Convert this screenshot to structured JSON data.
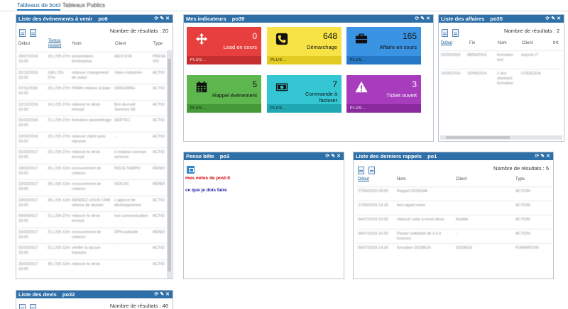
{
  "tabs": [
    {
      "label": "Tableaux de bord"
    },
    {
      "label": "Tableaux Publics"
    }
  ],
  "events_panel": {
    "title": "Liste des événements à venir",
    "code": "po6",
    "results": "Nombre de résultats : 20",
    "headers": [
      "Début",
      "Temps restant",
      "Nom",
      "Client",
      "Type"
    ],
    "rows": [
      [
        "28/07/2016 16:00",
        "18 j 22h 27m",
        "présentation d'entreprise",
        "AIEX HTA",
        "PRESE VIS"
      ],
      [
        "01/12/2016 10:00",
        "148 j 22h 27m",
        "relancer changement de statut",
        "Voleo Industries",
        "ACTIO"
      ],
      [
        "07/11/2016 16:00",
        "23 j 22h 27m",
        "PRAKI relance & base",
        "GREENING",
        "ACTIO"
      ],
      [
        "12/12/2016 16:00",
        "14 j 22h 27m",
        "relancer le devis envoyé",
        "Bon-Accueil Services SE",
        "ACTIO"
      ],
      [
        "01/02/2016 16:00",
        "21 j 22h 27m",
        "formation paramétrage",
        "SERTEC",
        "ACTIO"
      ],
      [
        "22/02/2016 16:00",
        "23 j 22h 27m",
        "relancer client sans réponse",
        "-",
        "ACTIO"
      ],
      [
        "01/02/2017 16:00",
        "23 j 22h 27m",
        "relancer le devis envoyé",
        "e-malaise concept services",
        "ACTIO"
      ],
      [
        "18/02/2017 16:00",
        "25 j 22h 12m",
        "recouvrement de créance",
        "PIZZA TEMPO",
        "RENDI"
      ],
      [
        "22/02/2017 16:00",
        "28 j 22h 12m",
        "recouvrement de créance",
        "ISOLOC",
        "RENDI"
      ],
      [
        "23/03/2017 16:00",
        "28 j 22h 12m",
        "RENDEZ-VOUS CRM relance de dossier",
        "L'agence de développement",
        "ACTIO"
      ],
      [
        "04/04/2017 16:00",
        "21 j 22h 27m",
        "relancer le devis envoyé",
        "eox communication",
        "ACTIO"
      ],
      [
        "15/03/2017 16:00",
        "21 j 22h 12m",
        "recouvrement de créance",
        "DPH publicité",
        "RENDI"
      ],
      [
        "01/03/2017 16:00",
        "21 j 22h 12m",
        "vérifier la facture impayée",
        "-",
        "ACTIO"
      ],
      [
        "26/03/2017 16:00",
        "30 j 22h 12m",
        "relancer le devis",
        "-",
        "ACTIO"
      ]
    ]
  },
  "indicators_panel": {
    "title": "Mes indicateurs",
    "code": "po39",
    "more_label": "PLUS...",
    "tiles": [
      {
        "value": "0",
        "label": "Lead en cours",
        "icon": "move-arrows-icon",
        "color": "#e63f3d",
        "dark": "#c52f2e",
        "text": "#ffffff"
      },
      {
        "value": "648",
        "label": "Démarchage",
        "icon": "phone-icon",
        "color": "#f8e346",
        "dark": "#e4cb22",
        "text": "#111111"
      },
      {
        "value": "165",
        "label": "Affaire en cours",
        "icon": "briefcase-icon",
        "color": "#3a93e3",
        "dark": "#2478c6",
        "text": "#111111"
      },
      {
        "value": "5",
        "label": "Rappel événement",
        "icon": "calendar-icon",
        "color": "#5db64e",
        "dark": "#439a36",
        "text": "#111111"
      },
      {
        "value": "7",
        "label": "Commande à facturer",
        "icon": "money-icon",
        "color": "#35c6d3",
        "dark": "#20a7b4",
        "text": "#111111"
      },
      {
        "value": "3",
        "label": "Ticket ouvert",
        "icon": "warning-icon",
        "color": "#a73cbd",
        "dark": "#8a2a9e",
        "text": "#ffffff"
      }
    ]
  },
  "deals_panel": {
    "title": "Liste des affaires",
    "code": "po35",
    "results": "Nombre de résultats : 2",
    "headers": [
      "Début",
      "Fin",
      "Nom",
      "Client",
      "tHt"
    ],
    "rows": [
      [
        "02/05/2016",
        "08/06/2016",
        "formation test",
        "exporio IT",
        ""
      ],
      [
        "15/05/2016",
        "15/06/2016",
        "2 ans standard formation",
        "CODEQUA",
        ""
      ]
    ]
  },
  "memo_panel": {
    "title": "Pense bête",
    "code": "po3",
    "note1": "mes notes de post-it",
    "note2": "ce que je dois faire"
  },
  "reminders_panel": {
    "title": "Liste des derniers rappels",
    "code": "po1",
    "results": "Nombre de résultats : 5",
    "headers": [
      "Début",
      "Nom",
      "Client",
      "Type"
    ],
    "rows": [
      [
        "27/06/2016 09:00",
        "Rappel CODEMA",
        "-",
        "ACTION"
      ],
      [
        "27/06/2016 14:30",
        "test rappel news",
        "-",
        "ACTION"
      ],
      [
        "04/07/2016 10:00",
        "relancer suite à envoi devis",
        "Rubble",
        "ACTION"
      ],
      [
        "04/07/2016 15:00",
        "Passer solidarité de 3 à 4 licences",
        "-",
        "ACTION"
      ],
      [
        "06/07/2016 14:30",
        "formation DOSBUS",
        "DOSBUS",
        "FORMATION"
      ]
    ]
  },
  "quotes_panel": {
    "title": "Liste des devis",
    "code": "po32",
    "results": "Nombre de résultats : 46"
  }
}
